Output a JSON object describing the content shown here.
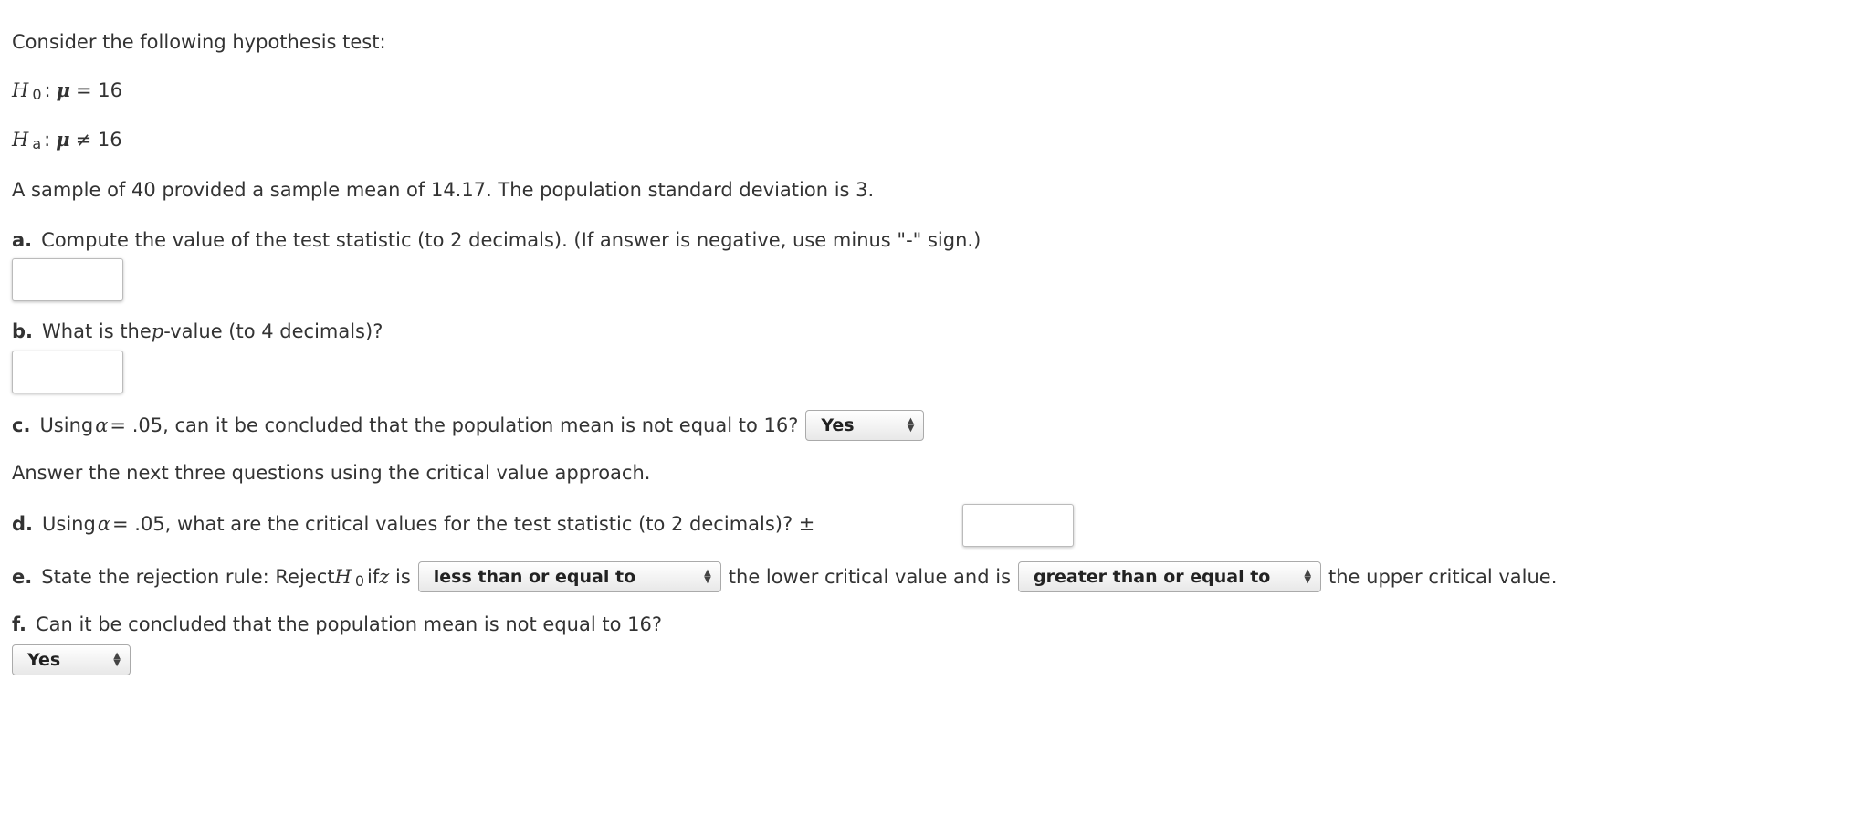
{
  "intro": "Consider the following hypothesis test:",
  "h0": {
    "H": "H",
    "sub": "0",
    "colon": ":",
    "mu": "μ",
    "rel": "= 16"
  },
  "ha": {
    "H": "H",
    "sub": "a",
    "colon": ":",
    "mu": "μ",
    "rel": "≠ 16"
  },
  "sample": "A sample of 40 provided a sample mean of 14.17. The population standard deviation is 3.",
  "qa": {
    "label": "a.",
    "text": "Compute the value of the test statistic (to 2 decimals). (If answer is negative, use minus \"-\" sign.)",
    "value": ""
  },
  "qb": {
    "label": "b.",
    "text1": "What is the ",
    "p": "p",
    "text2": "-value (to 4 decimals)?",
    "value": ""
  },
  "qc": {
    "label": "c.",
    "text1": "Using ",
    "alpha": "α",
    "text2": " = .05, can it be concluded that the population mean is not equal to 16?",
    "selected": "Yes"
  },
  "note": "Answer the next three questions using the critical value approach.",
  "qd": {
    "label": "d.",
    "text1": "Using ",
    "alpha": "α",
    "text2": " = .05, what are the critical values for the test statistic (to 2 decimals)? ±",
    "value": ""
  },
  "qe": {
    "label": "e.",
    "text1": "State the rejection rule: Reject ",
    "H": "H",
    "sub": "0",
    "text2": " if ",
    "z": "z",
    "text3": " is",
    "select1": "less than or equal to",
    "text4": "the lower critical value and is",
    "select2": "greater than or equal to",
    "text5": "the upper critical value."
  },
  "qf": {
    "label": "f.",
    "text": "Can it be concluded that the population mean is not equal to 16?",
    "selected": "Yes"
  },
  "icons": {
    "select_arrows": "up-down-arrows-icon"
  }
}
